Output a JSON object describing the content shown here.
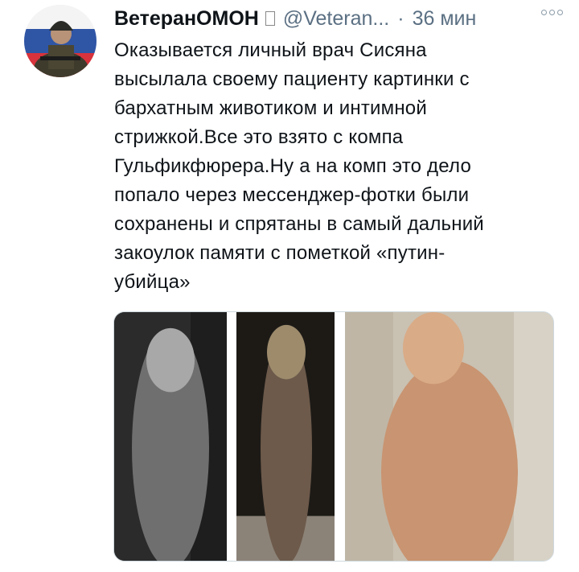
{
  "header": {
    "display_name": "ВетеранОМОН",
    "handle": "@Veteran...",
    "separator": "·",
    "time": "36 мин"
  },
  "tweet": {
    "lines": [
      "Оказывается личный врач Сисяна",
      "высылала своему пациенту картинки с",
      "бархатным животиком и интимной",
      "стрижкой.Все это взято с компа",
      "Гульфикфюрера.Ну а на комп это дело",
      "попало через мессенджер-фотки были",
      "сохранены и спрятаны в самый дальний",
      "закоулок памяти с пометкой «путин-",
      "убийца»"
    ]
  },
  "icons": {
    "avatar": "avatar-image",
    "verified": "badge-icon",
    "more": "more-options-icon"
  },
  "media": {
    "count": 3
  },
  "colors": {
    "text": "#0f1419",
    "secondary": "#5b7083",
    "border": "#cfd9de"
  }
}
